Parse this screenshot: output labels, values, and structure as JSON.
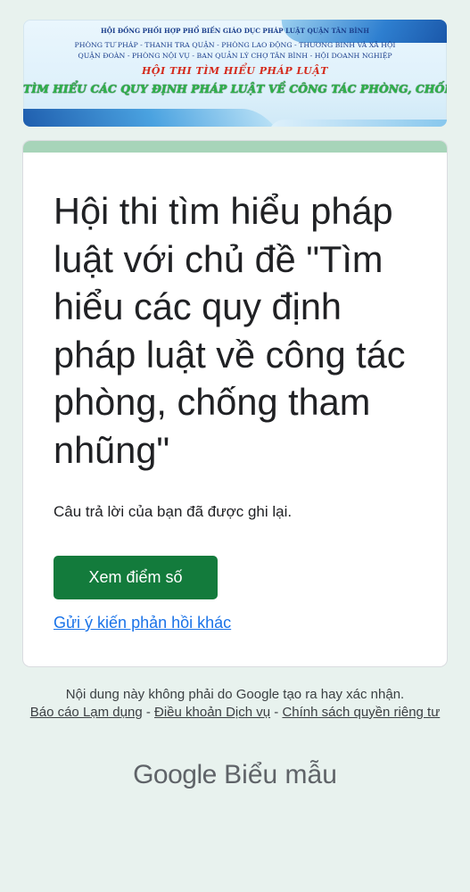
{
  "banner": {
    "line1": "HỘI ĐỒNG PHỐI HỢP PHỔ BIẾN GIÁO DỤC PHÁP LUẬT QUẬN TÂN BÌNH",
    "line2": "PHÒNG TƯ PHÁP - THANH TRA QUẬN - PHÒNG LAO ĐỘNG - THƯƠNG BINH VÀ XÃ HỘI",
    "line3": "QUẬN ĐOÀN - PHÒNG NỘI VỤ - BAN QUẢN LÝ CHỢ TÂN BÌNH - HỘI DOANH NGHIỆP",
    "line4": "HỘI THI TÌM HIỂU PHÁP LUẬT",
    "line5": "TÌM HIỂU CÁC QUY ĐỊNH PHÁP LUẬT VỀ CÔNG TÁC PHÒNG, CHỐNG THAM NHŨNG"
  },
  "form": {
    "title": "Hội thi tìm hiểu pháp luật với chủ đề \"Tìm hiểu các quy định pháp luật về công tác phòng, chống tham nhũng\"",
    "confirmation": "Câu trả lời của bạn đã được ghi lại.",
    "view_score_label": "Xem điểm số",
    "resubmit_link": "Gửi ý kiến phản hồi khác"
  },
  "footer": {
    "disclaimer": "Nội dung này không phải do Google tạo ra hay xác nhận.",
    "report_abuse": "Báo cáo Lạm dụng",
    "separator": " - ",
    "terms": "Điều khoản Dịch vụ",
    "privacy": "Chính sách quyền riêng tư",
    "logo_brand": "Google",
    "logo_product": "Biểu mẫu"
  },
  "colors": {
    "page_bg": "#e8f2ee",
    "accent_strip": "#a7d4b9",
    "button": "#137b3c",
    "link": "#1a73e8"
  }
}
